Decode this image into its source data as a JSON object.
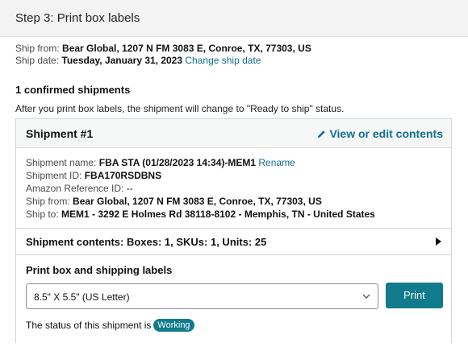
{
  "step": {
    "title": "Step 3: Print box labels"
  },
  "ship_from": {
    "label": "Ship from:",
    "value": "Bear Global, 1207 N FM 3083 E,  Conroe,  TX,  77303, US"
  },
  "ship_date": {
    "label": "Ship date:",
    "value": "Tuesday, January 31, 2023",
    "change_link": "Change ship date"
  },
  "confirmed": {
    "title": "1 confirmed shipments",
    "description": "After you print box labels, the shipment will change to \"Ready to ship\" status."
  },
  "shipment": {
    "title": "Shipment #1",
    "edit_link": "View or edit contents",
    "name_label": "Shipment name:",
    "name_value": "FBA STA (01/28/2023 14:34)-MEM1",
    "rename_link": "Rename",
    "id_label": "Shipment ID:",
    "id_value": "FBA170RSDBNS",
    "ref_label": "Amazon Reference ID:",
    "ref_value": "--",
    "from_label": "Ship from:",
    "from_value": "Bear Global, 1207 N FM 3083 E,  Conroe,  TX,  77303, US",
    "to_label": "Ship to:",
    "to_value": "MEM1 - 3292 E Holmes Rd  38118-8102 - Memphis,  TN - United States",
    "contents": "Shipment contents: Boxes: 1, SKUs: 1, Units: 25",
    "print_title": "Print box and shipping labels",
    "paper_size": "8.5\" X 5.5\" (US Letter)",
    "print_button": "Print",
    "status_text": "The status of this shipment is",
    "status_badge": "Working"
  },
  "colors": {
    "accent": "#117a8b",
    "link": "#0f6f8f"
  }
}
